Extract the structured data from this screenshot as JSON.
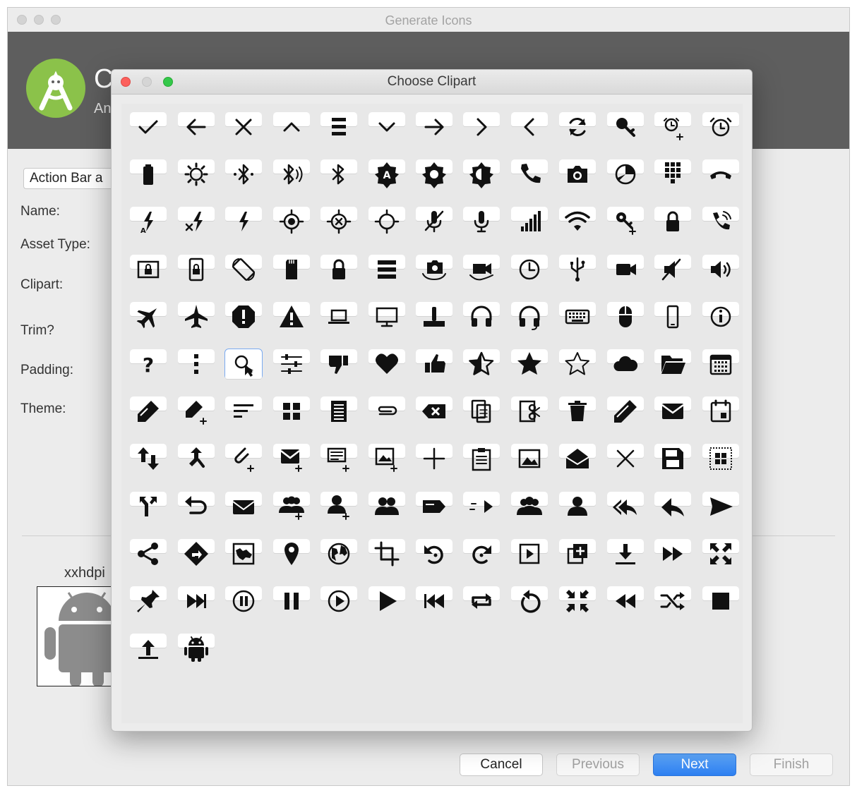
{
  "main_window": {
    "title": "Generate Icons",
    "header_title": "C",
    "header_subtitle": "An",
    "asset_combo_value": "Action Bar a",
    "labels": {
      "name": "Name:",
      "asset_type": "Asset Type:",
      "clipart": "Clipart:",
      "trim": "Trim?",
      "padding": "Padding:",
      "theme": "Theme:"
    },
    "preview_label": "xxhdpi",
    "buttons": {
      "cancel": "Cancel",
      "previous": "Previous",
      "next": "Next",
      "finish": "Finish"
    }
  },
  "dialog": {
    "title": "Choose Clipart",
    "selected_icon": "search-icon",
    "icons": [
      "check-icon",
      "arrow-back-icon",
      "close-icon",
      "expand-less-icon",
      "menu-icon",
      "expand-more-icon",
      "arrow-forward-icon",
      "chevron-right-icon",
      "chevron-left-icon",
      "refresh-icon",
      "key-icon",
      "alarm-add-icon",
      "alarm-icon",
      "battery-icon",
      "brightness-icon",
      "bluetooth-connected-icon",
      "bluetooth-audio-icon",
      "bluetooth-icon",
      "brightness-auto-icon",
      "brightness-high-icon",
      "brightness-medium-icon",
      "phone-icon",
      "camera-icon",
      "data-usage-icon",
      "dialpad-icon",
      "call-end-icon",
      "flash-auto-icon",
      "flash-off-icon",
      "flash-on-icon",
      "gps-fixed-icon",
      "gps-off-icon",
      "gps-not-fixed-icon",
      "mic-off-icon",
      "mic-icon",
      "signal-icon",
      "wifi-icon",
      "vpn-key-icon",
      "lock-icon",
      "phone-in-talk-icon",
      "screen-lock-icon",
      "screen-lock-portrait-icon",
      "screen-rotation-icon",
      "sd-card-icon",
      "lock-closed-icon",
      "storage-icon",
      "switch-camera-icon",
      "switch-video-icon",
      "clock-icon",
      "usb-icon",
      "videocam-icon",
      "volume-off-icon",
      "volume-up-icon",
      "airplane-mode-icon",
      "flight-icon",
      "report-icon",
      "warning-icon",
      "laptop-icon",
      "desktop-icon",
      "joystick-icon",
      "headset-icon",
      "headset-mic-icon",
      "keyboard-icon",
      "mouse-icon",
      "smartphone-icon",
      "info-icon",
      "help-icon",
      "more-vert-icon",
      "search-icon",
      "tune-icon",
      "thumb-down-icon",
      "favorite-icon",
      "thumb-up-icon",
      "star-half-icon",
      "star-icon",
      "star-border-icon",
      "cloud-icon",
      "folder-open-icon",
      "calendar-icon",
      "edit-icon",
      "edit-add-icon",
      "sort-icon",
      "view-module-icon",
      "list-doc-icon",
      "attach-icon",
      "backspace-icon",
      "copy-icon",
      "cut-icon",
      "delete-icon",
      "pen-icon",
      "mail-icon",
      "event-icon",
      "import-export-icon",
      "call-merge-icon",
      "attach-add-icon",
      "mail-add-icon",
      "text-add-icon",
      "image-add-icon",
      "add-icon",
      "clipboard-icon",
      "image-icon",
      "drafts-icon",
      "clear-icon",
      "save-icon",
      "select-all-icon",
      "call-split-icon",
      "undo-icon",
      "open-mail-icon",
      "group-add-icon",
      "person-add-icon",
      "people-icon",
      "label-icon",
      "forward-arrow-icon",
      "group-icon",
      "person-icon",
      "reply-all-icon",
      "reply-icon",
      "send-icon",
      "share-icon",
      "directions-icon",
      "map-icon",
      "place-icon",
      "public-icon",
      "crop-icon",
      "rotate-left-icon",
      "rotate-right-icon",
      "slideshow-icon",
      "library-add-icon",
      "download-icon",
      "fast-forward-icon",
      "fullscreen-icon",
      "pin-icon",
      "skip-next-icon",
      "pause-circle-icon",
      "pause-icon",
      "play-circle-icon",
      "play-icon",
      "skip-previous-icon",
      "repeat-icon",
      "replay-icon",
      "fullscreen-exit-icon",
      "rewind-icon",
      "shuffle-icon",
      "stop-icon",
      "upload-icon",
      "android-icon"
    ]
  }
}
